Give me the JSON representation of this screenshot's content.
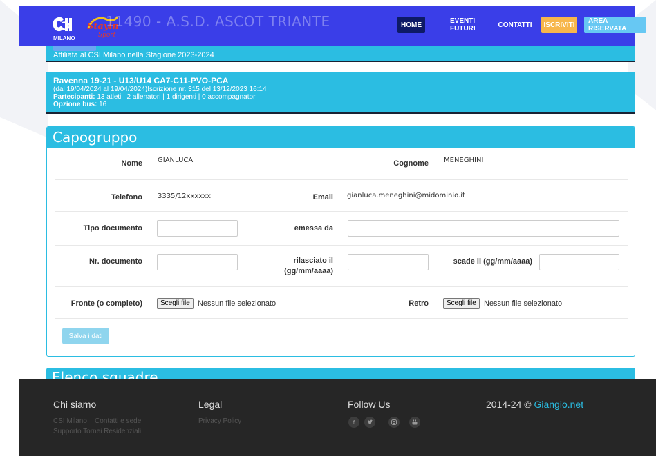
{
  "colors": {
    "navbar": "#3a3ee8",
    "accent": "#2bbde2",
    "home_active": "#0d1a66",
    "iscriviti": "#f7b64b",
    "area_riservata": "#67c8f3",
    "footer": "#262626"
  },
  "brand": {
    "logo_text": "MILANO",
    "site_title": "11490 - A.S.D. ASCOT TRIANTE",
    "affiliation": "Affiliata al CSI Milano nella Stagione 2023-2024"
  },
  "nav": {
    "home": "HOME",
    "eventi": "EVENTI FUTURI",
    "contatti": "CONTATTI",
    "iscriviti": "ISCRIVITI",
    "area": "AREA RISERVATA"
  },
  "event": {
    "title": "Ravenna 19-21 - U13/U14 CA7-C11-PVO-PCA",
    "dates": "(dal 19/04/2024 al 19/04/2024)Iscrizione nr. 315 del 13/12/2023 16:14",
    "participants_label": "Partecipanti:",
    "participants": "13 atleti | 2 allenatori | 1 dirigenti | 0 accompagnatori",
    "bus_label": "Opzione bus:",
    "bus": "16"
  },
  "capogruppo": {
    "heading": "Capogruppo",
    "nome_label": "Nome",
    "nome": "GIANLUCA",
    "cognome_label": "Cognome",
    "cognome": "MENEGHINI",
    "telefono_label": "Telefono",
    "telefono": "3335/12xxxxxx",
    "email_label": "Email",
    "email": "gianluca.meneghini@midominio.it",
    "tipo_doc_label": "Tipo documento",
    "emessa_label": "emessa da",
    "nr_doc_label": "Nr. documento",
    "rilasciato_label_1": "rilasciato il",
    "rilasciato_label_2": "(gg/mm/aaaa)",
    "scade_label": "scade il (gg/mm/aaaa)",
    "fronte_label": "Fronte (o completo)",
    "retro_label": "Retro",
    "file_button": "Scegli file",
    "file_none": "Nessun file selezionato",
    "save": "Salva i dati"
  },
  "squadre": {
    "heading": "Elenco squadre"
  },
  "footer": {
    "chi_siamo": "Chi siamo",
    "csi_milano": "CSI Milano",
    "contatti_sede": "Contatti e sede",
    "supporto": "Supporto Tornei Residenziali",
    "legal": "Legal",
    "privacy": "Privacy Policy",
    "follow": "Follow Us",
    "copyright": "2014-24 ©",
    "copyright_link": "Giangio.net"
  }
}
